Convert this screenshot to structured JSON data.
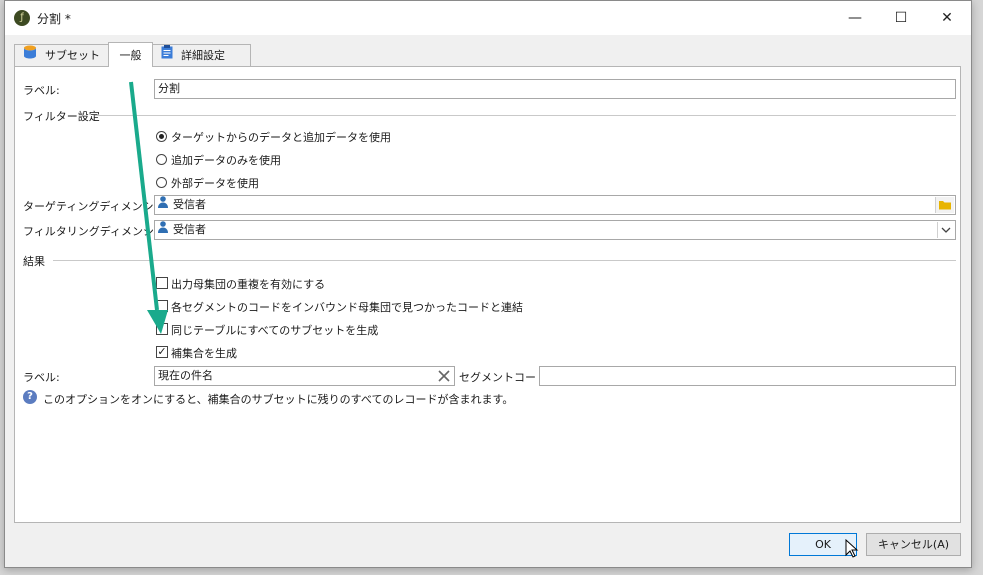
{
  "window": {
    "title": "分割 *",
    "controls": {
      "minimize": "—",
      "maximize": "☐",
      "close": "✕"
    }
  },
  "tabs": [
    {
      "label": "サブセット"
    },
    {
      "label": "一般"
    },
    {
      "label": "詳細設定"
    }
  ],
  "general": {
    "label_caption": "ラベル:",
    "label_value": "分割",
    "filter_section": "フィルター設定",
    "radios": [
      {
        "label": "ターゲットからのデータと追加データを使用",
        "selected": true
      },
      {
        "label": "追加データのみを使用",
        "selected": false
      },
      {
        "label": "外部データを使用",
        "selected": false
      }
    ],
    "targeting_caption": "ターゲティングディメンション:",
    "targeting_value": "受信者",
    "filtering_caption": "フィルタリングディメンション:",
    "filtering_value": "受信者",
    "result_section": "結果",
    "checkboxes": [
      {
        "label": "出力母集団の重複を有効にする",
        "checked": false
      },
      {
        "label": "各セグメントのコードをインバウンド母集団で見つかったコードと連結",
        "checked": false
      },
      {
        "label": "同じテーブルにすべてのサブセットを生成",
        "checked": false
      },
      {
        "label": "補集合を生成",
        "checked": true
      }
    ],
    "complement_label_caption": "ラベル:",
    "complement_label_value": "現在の件名",
    "segment_code_caption": "セグメントコード:",
    "segment_code_value": "",
    "info_text": "このオプションをオンにすると、補集合のサブセットに残りのすべてのレコードが含まれます。"
  },
  "buttons": {
    "ok": "OK",
    "cancel": "キャンセル(A)"
  },
  "colors": {
    "annotation_arrow": "#1aaa8c",
    "folder": "#e8b400",
    "person": "#2f6fb3",
    "info": "#5b7cc0"
  }
}
